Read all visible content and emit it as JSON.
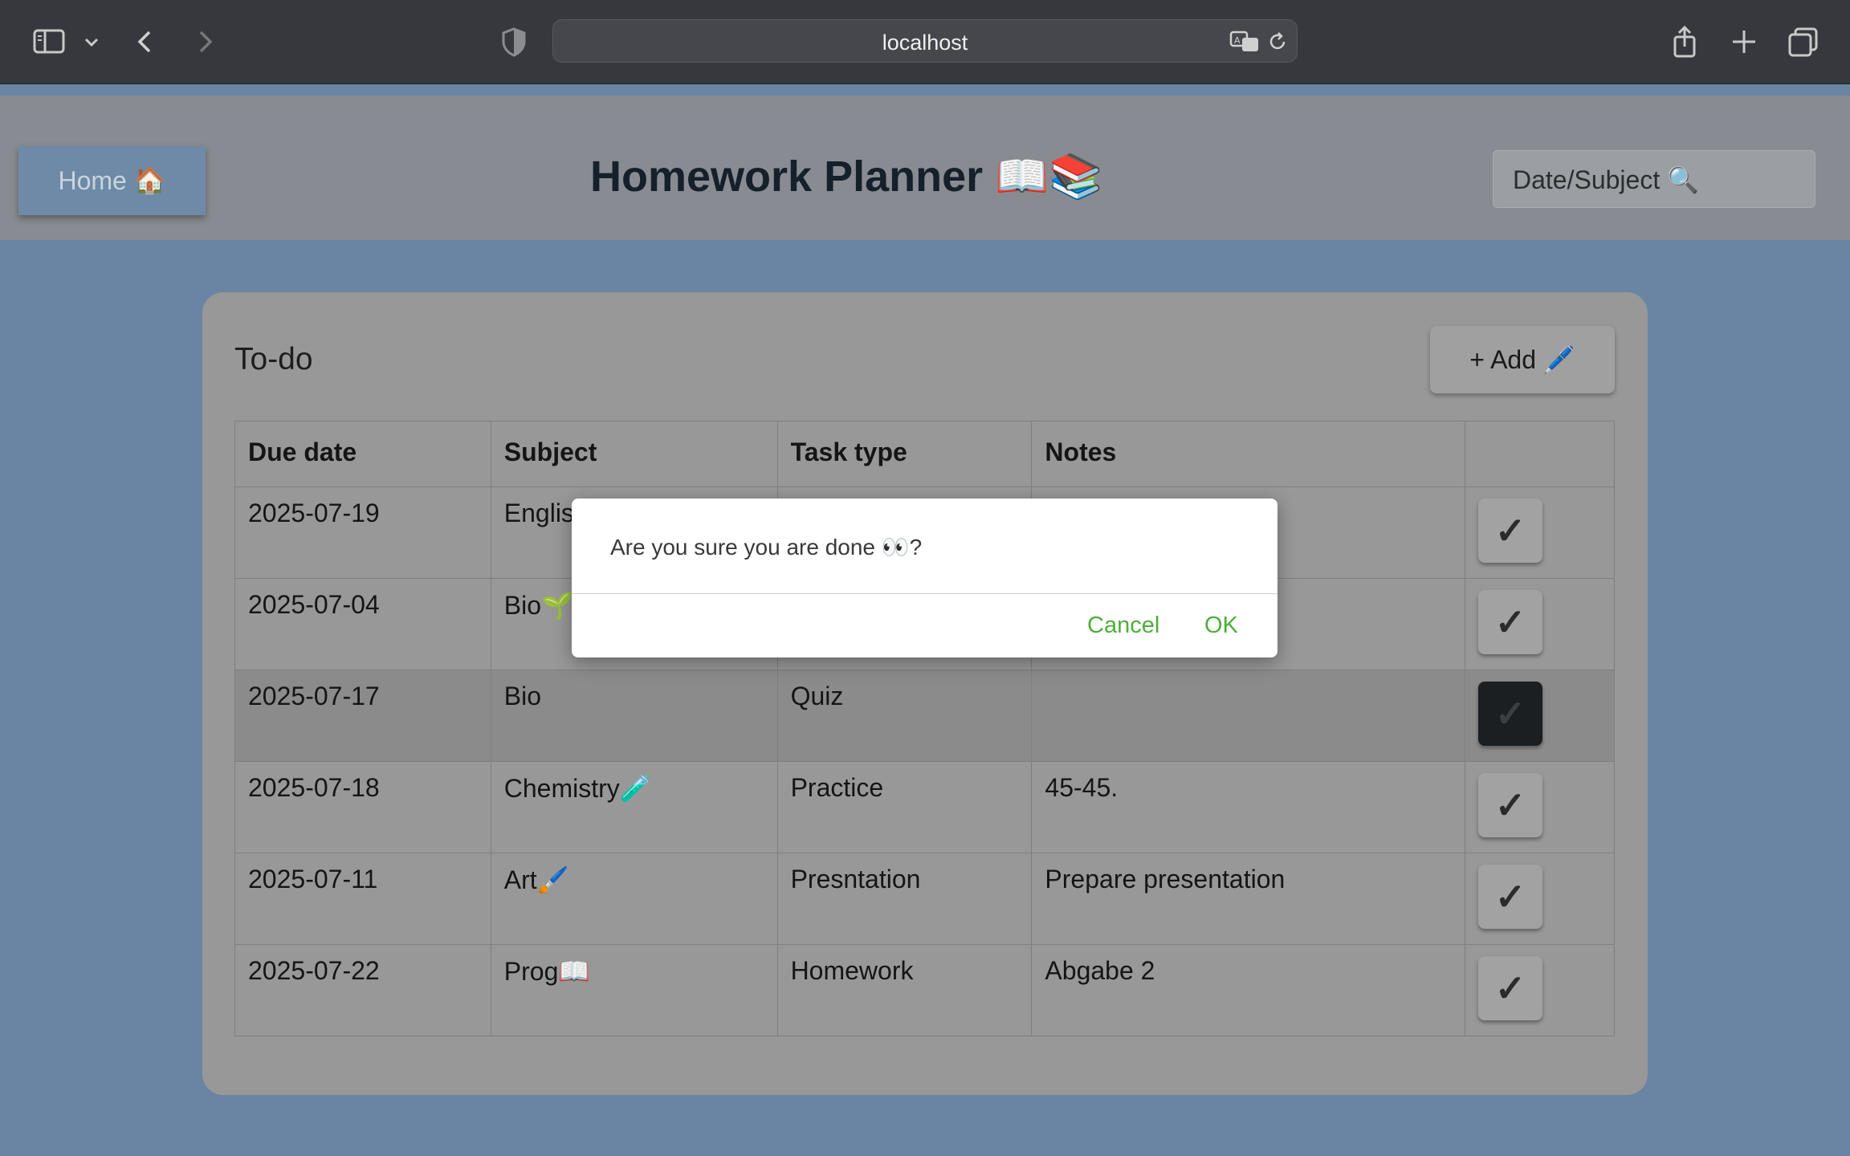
{
  "browser": {
    "url": "localhost"
  },
  "header": {
    "home_label": "Home 🏠",
    "title": "Homework Planner 📖📚",
    "search_placeholder": "Date/Subject 🔍"
  },
  "card": {
    "title": "To-do",
    "add_label": "+ Add 🖊️"
  },
  "table": {
    "headers": [
      "Due date",
      "Subject",
      "Task type",
      "Notes",
      ""
    ],
    "rows": [
      {
        "due": "2025-07-19",
        "subject": "Englis",
        "type": "",
        "notes": ""
      },
      {
        "due": "2025-07-04",
        "subject": "Bio🌱",
        "type": "",
        "notes": ""
      },
      {
        "due": "2025-07-17",
        "subject": "Bio",
        "type": "Quiz",
        "notes": ""
      },
      {
        "due": "2025-07-18",
        "subject": "Chemistry🧪",
        "type": "Practice",
        "notes": "45-45."
      },
      {
        "due": "2025-07-11",
        "subject": "Art🖌️",
        "type": "Presntation",
        "notes": "Prepare presentation"
      },
      {
        "due": "2025-07-22",
        "subject": "Prog📖",
        "type": "Homework",
        "notes": "Abgabe 2"
      }
    ],
    "check_glyph": "✓"
  },
  "dialog": {
    "message": "Are you sure you are done 👀?",
    "cancel": "Cancel",
    "ok": "OK",
    "accent": "#4caf3a"
  }
}
